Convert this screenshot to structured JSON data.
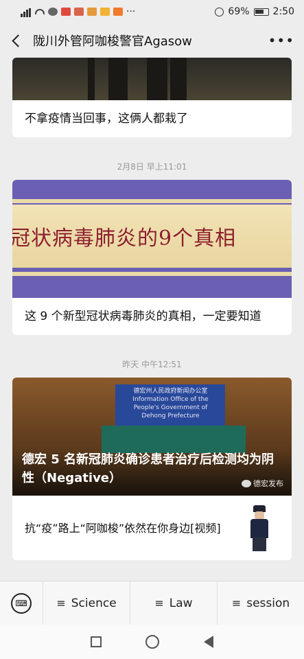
{
  "status_bar": {
    "signal_label": "4G",
    "battery_percent": "69%",
    "time": "2:50"
  },
  "nav": {
    "title": "陇川外管阿咖梭警官Agasow",
    "more": "•••"
  },
  "feed": {
    "card1": {
      "title": "不拿疫情当回事，这俩人都栽了"
    },
    "time2": "2月8日 早上11:01",
    "card2": {
      "image_text": "冠状病毒肺炎的9个真相",
      "title": "这 9 个新型冠状病毒肺炎的真相，一定要知道"
    },
    "time3": "昨天 中午12:51",
    "card3": {
      "image_header": "德宏州人民政府新闻办公室",
      "image_header_en": "Information Office of the People's Government of Dehong Prefecture",
      "overlay_title": "德宏 5 名新冠肺炎确诊患者治疗后检测均为阴性（Negative）",
      "source": "德宏发布",
      "sub_title": "抗“疫”路上“阿咖梭”依然在你身边[视频]"
    }
  },
  "menu": {
    "items": [
      {
        "label": "Science"
      },
      {
        "label": "Law"
      },
      {
        "label": "session"
      }
    ]
  }
}
